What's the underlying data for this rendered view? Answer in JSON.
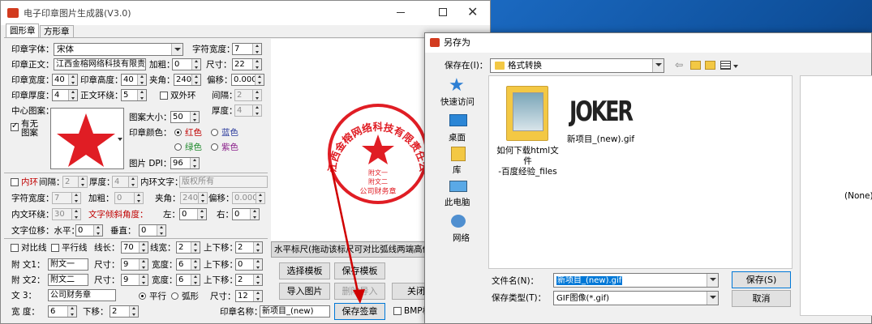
{
  "app": {
    "title": "电子印章图片生成器(V3.0)",
    "tabs": [
      "圆形章",
      "方形章"
    ],
    "font": {
      "label": "印章字体：",
      "value": "宋体"
    },
    "char_width": {
      "label": "字符宽度：",
      "value": "7"
    },
    "main_text": {
      "label": "印章正文：",
      "value": "江西金榕网络科技有限责"
    },
    "bold": {
      "label": "加粗：",
      "value": "0"
    },
    "size": {
      "label": "尺寸：",
      "value": "22"
    },
    "width": {
      "label": "印章宽度：",
      "value": "40"
    },
    "height": {
      "label": "印章高度：",
      "value": "40"
    },
    "angle": {
      "label": "夹角：",
      "value": "240"
    },
    "offset": {
      "label": "偏移：",
      "value": "0.000"
    },
    "thickness": {
      "label": "印章厚度：",
      "value": "4"
    },
    "text_ring": {
      "label": "正文环绕：",
      "value": "5"
    },
    "double_ring": {
      "label": "双外环",
      "checked": false
    },
    "gap": {
      "label": "间隔：",
      "value": "2"
    },
    "thickness2": {
      "label": "厚度：",
      "value": "4"
    },
    "center_pattern": {
      "label": "中心图案：",
      "checkbox_label": "有无\n图案",
      "checked": true
    },
    "pattern_size": {
      "label": "图案大小：",
      "value": "50"
    },
    "color": {
      "label": "印章颜色：",
      "options": [
        "红色",
        "蓝色",
        "绿色",
        "紫色"
      ],
      "selected": 0
    },
    "dpi": {
      "label": "图片 DPI：",
      "value": "96"
    },
    "inner_ring": {
      "label": "内环",
      "checked": false,
      "gap_label": "间隔：",
      "gap": "2",
      "thick_label": "厚度：",
      "thick": "4",
      "text_label": "内环文字：",
      "text": "版权所有"
    },
    "inner_char_width": {
      "label": "字符宽度：",
      "value": "7"
    },
    "inner_bold": {
      "label": "加粗：",
      "value": "0"
    },
    "inner_angle": {
      "label": "夹角：",
      "value": "240"
    },
    "inner_offset": {
      "label": "偏移：",
      "value": "0.000"
    },
    "inner_text_ring": {
      "label": "内文环绕：",
      "value": "30"
    },
    "tilt_label": "文字倾斜角度：",
    "tilt_left": {
      "label": "左：",
      "value": "0"
    },
    "tilt_right": {
      "label": "右：",
      "value": "0"
    },
    "text_shift": {
      "label": "文字位移：水平：",
      "h": "0",
      "v_label": "垂直：",
      "v": "0"
    },
    "contrast": {
      "label": "对比线",
      "checked": false
    },
    "parallel": {
      "label": "平行线",
      "checked": false
    },
    "line_len": {
      "label": "线长：",
      "value": "70"
    },
    "line_width": {
      "label": "线宽：",
      "value": "2"
    },
    "line_shift": {
      "label": "上下移：",
      "value": "2"
    },
    "sub_texts": [
      {
        "label": "附  文1：",
        "value": "附文一",
        "size_label": "尺寸：",
        "size": "9",
        "w_label": "宽度：",
        "w": "6",
        "shift_label": "上下移：",
        "shift": "0"
      },
      {
        "label": "附  文2：",
        "value": "附文二",
        "size_label": "尺寸：",
        "size": "9",
        "w_label": "宽度：",
        "w": "6",
        "shift_label": "上下移：",
        "shift": "2"
      }
    ],
    "sub_text3": {
      "label": "文  3：",
      "value": "公司财务章",
      "opt_parallel": "平行",
      "opt_arc": "弧形",
      "size_label": "尺寸：",
      "size": "12"
    },
    "bottom_width": {
      "label": "宽    度：",
      "value": "6"
    },
    "bottom_shift": {
      "label": "下移：",
      "value": "2"
    },
    "seal_name": {
      "label": "印章名称：",
      "value": "新项目_(new)"
    },
    "ruler_hint": "水平标尺(拖动该标尺可对比弧线两端高低",
    "buttons": {
      "select_tpl": "选择模板",
      "save_tpl": "保存模板",
      "import_img": "导入图片",
      "delete_import": "删除导入",
      "close": "关闭",
      "save_seal": "保存签章",
      "bmp": "BMP格"
    },
    "seal_preview": {
      "ring_text": "江西金榕网络科技有限责任公司",
      "sub1": "附文一",
      "sub2": "附文二",
      "sub3": "公司财务章"
    }
  },
  "dialog": {
    "title": "另存为",
    "save_in_label": "保存在(I)：",
    "folder": "格式转换",
    "places": [
      "快速访问",
      "桌面",
      "库",
      "此电脑",
      "网络"
    ],
    "files": [
      {
        "name": "如何下载html文件\n-百度经验_files",
        "type": "folder"
      },
      {
        "name": "新项目_(new).gif",
        "type": "gif",
        "thumb_text": "JOKER"
      }
    ],
    "preview_text": "(None)",
    "filename_label": "文件名(N)：",
    "filename": "新项目_(new).gif",
    "filetype_label": "保存类型(T)：",
    "filetype": "GIF图像(*.gif)",
    "save_button": "保存(S)",
    "cancel_button": "取消"
  },
  "colors": {
    "seal_red": "#e01d24",
    "accent": "#0078d7"
  }
}
